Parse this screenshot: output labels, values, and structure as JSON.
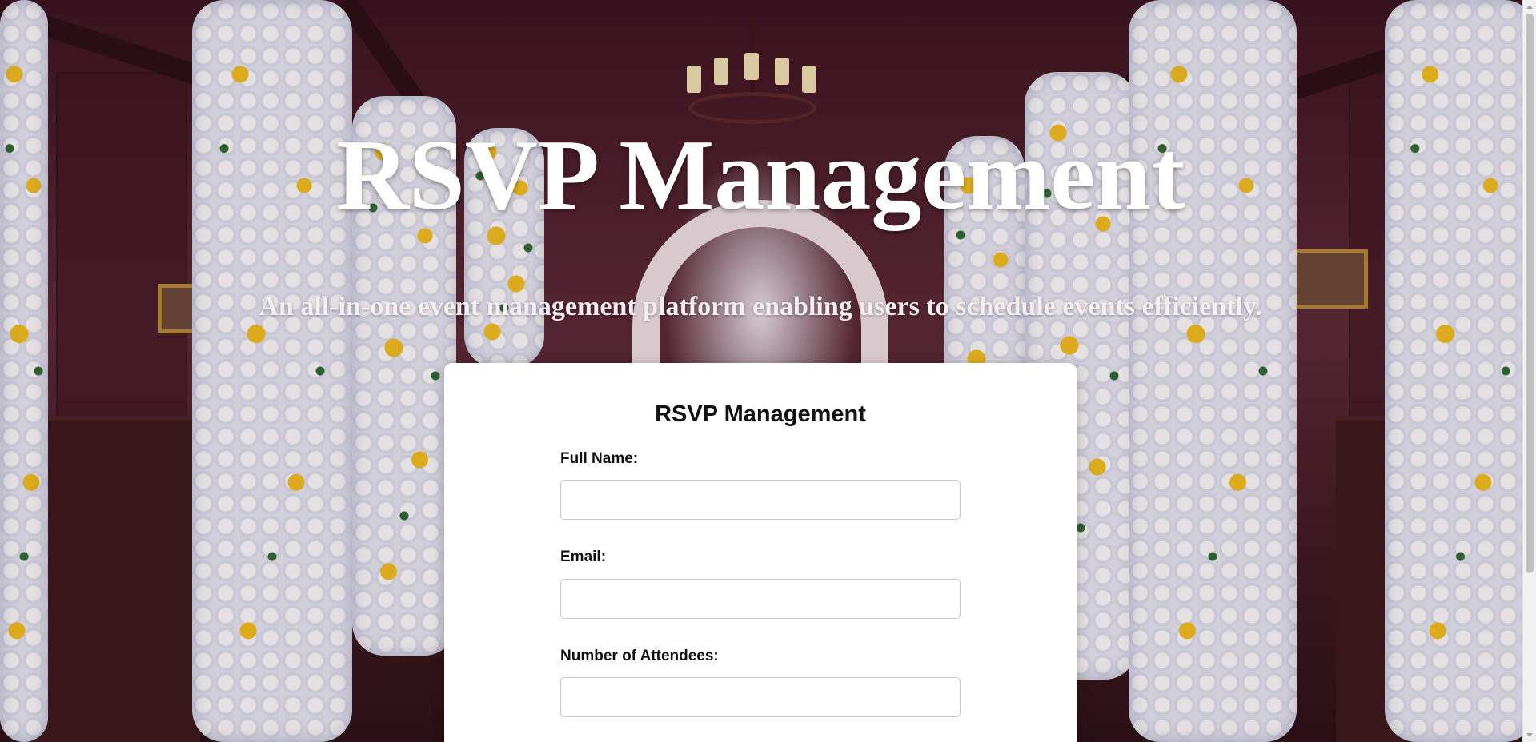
{
  "hero": {
    "title": "RSVP Management",
    "subtitle": "An all-in-one event management platform enabling users to schedule events efficiently."
  },
  "form": {
    "title": "RSVP Management",
    "fields": [
      {
        "label": "Full Name:",
        "value": "",
        "placeholder": ""
      },
      {
        "label": "Email:",
        "value": "",
        "placeholder": ""
      },
      {
        "label": "Number of Attendees:",
        "value": "",
        "placeholder": ""
      }
    ]
  },
  "background": {
    "icon": "wedding-chapel-flowers-photo"
  },
  "colors": {
    "card": "#ffffff",
    "hero_text": "#ffffff",
    "flower_yellow": "#f4c21f"
  }
}
